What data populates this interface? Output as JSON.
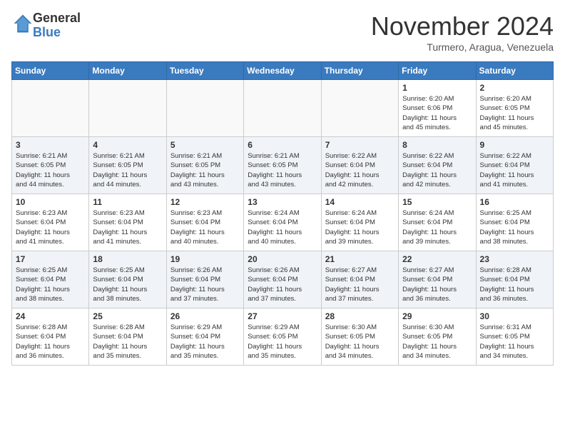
{
  "logo": {
    "line1": "General",
    "line2": "Blue"
  },
  "title": "November 2024",
  "location": "Turmero, Aragua, Venezuela",
  "weekdays": [
    "Sunday",
    "Monday",
    "Tuesday",
    "Wednesday",
    "Thursday",
    "Friday",
    "Saturday"
  ],
  "weeks": [
    [
      {
        "day": "",
        "info": ""
      },
      {
        "day": "",
        "info": ""
      },
      {
        "day": "",
        "info": ""
      },
      {
        "day": "",
        "info": ""
      },
      {
        "day": "",
        "info": ""
      },
      {
        "day": "1",
        "info": "Sunrise: 6:20 AM\nSunset: 6:06 PM\nDaylight: 11 hours\nand 45 minutes."
      },
      {
        "day": "2",
        "info": "Sunrise: 6:20 AM\nSunset: 6:05 PM\nDaylight: 11 hours\nand 45 minutes."
      }
    ],
    [
      {
        "day": "3",
        "info": "Sunrise: 6:21 AM\nSunset: 6:05 PM\nDaylight: 11 hours\nand 44 minutes."
      },
      {
        "day": "4",
        "info": "Sunrise: 6:21 AM\nSunset: 6:05 PM\nDaylight: 11 hours\nand 44 minutes."
      },
      {
        "day": "5",
        "info": "Sunrise: 6:21 AM\nSunset: 6:05 PM\nDaylight: 11 hours\nand 43 minutes."
      },
      {
        "day": "6",
        "info": "Sunrise: 6:21 AM\nSunset: 6:05 PM\nDaylight: 11 hours\nand 43 minutes."
      },
      {
        "day": "7",
        "info": "Sunrise: 6:22 AM\nSunset: 6:04 PM\nDaylight: 11 hours\nand 42 minutes."
      },
      {
        "day": "8",
        "info": "Sunrise: 6:22 AM\nSunset: 6:04 PM\nDaylight: 11 hours\nand 42 minutes."
      },
      {
        "day": "9",
        "info": "Sunrise: 6:22 AM\nSunset: 6:04 PM\nDaylight: 11 hours\nand 41 minutes."
      }
    ],
    [
      {
        "day": "10",
        "info": "Sunrise: 6:23 AM\nSunset: 6:04 PM\nDaylight: 11 hours\nand 41 minutes."
      },
      {
        "day": "11",
        "info": "Sunrise: 6:23 AM\nSunset: 6:04 PM\nDaylight: 11 hours\nand 41 minutes."
      },
      {
        "day": "12",
        "info": "Sunrise: 6:23 AM\nSunset: 6:04 PM\nDaylight: 11 hours\nand 40 minutes."
      },
      {
        "day": "13",
        "info": "Sunrise: 6:24 AM\nSunset: 6:04 PM\nDaylight: 11 hours\nand 40 minutes."
      },
      {
        "day": "14",
        "info": "Sunrise: 6:24 AM\nSunset: 6:04 PM\nDaylight: 11 hours\nand 39 minutes."
      },
      {
        "day": "15",
        "info": "Sunrise: 6:24 AM\nSunset: 6:04 PM\nDaylight: 11 hours\nand 39 minutes."
      },
      {
        "day": "16",
        "info": "Sunrise: 6:25 AM\nSunset: 6:04 PM\nDaylight: 11 hours\nand 38 minutes."
      }
    ],
    [
      {
        "day": "17",
        "info": "Sunrise: 6:25 AM\nSunset: 6:04 PM\nDaylight: 11 hours\nand 38 minutes."
      },
      {
        "day": "18",
        "info": "Sunrise: 6:25 AM\nSunset: 6:04 PM\nDaylight: 11 hours\nand 38 minutes."
      },
      {
        "day": "19",
        "info": "Sunrise: 6:26 AM\nSunset: 6:04 PM\nDaylight: 11 hours\nand 37 minutes."
      },
      {
        "day": "20",
        "info": "Sunrise: 6:26 AM\nSunset: 6:04 PM\nDaylight: 11 hours\nand 37 minutes."
      },
      {
        "day": "21",
        "info": "Sunrise: 6:27 AM\nSunset: 6:04 PM\nDaylight: 11 hours\nand 37 minutes."
      },
      {
        "day": "22",
        "info": "Sunrise: 6:27 AM\nSunset: 6:04 PM\nDaylight: 11 hours\nand 36 minutes."
      },
      {
        "day": "23",
        "info": "Sunrise: 6:28 AM\nSunset: 6:04 PM\nDaylight: 11 hours\nand 36 minutes."
      }
    ],
    [
      {
        "day": "24",
        "info": "Sunrise: 6:28 AM\nSunset: 6:04 PM\nDaylight: 11 hours\nand 36 minutes."
      },
      {
        "day": "25",
        "info": "Sunrise: 6:28 AM\nSunset: 6:04 PM\nDaylight: 11 hours\nand 35 minutes."
      },
      {
        "day": "26",
        "info": "Sunrise: 6:29 AM\nSunset: 6:04 PM\nDaylight: 11 hours\nand 35 minutes."
      },
      {
        "day": "27",
        "info": "Sunrise: 6:29 AM\nSunset: 6:05 PM\nDaylight: 11 hours\nand 35 minutes."
      },
      {
        "day": "28",
        "info": "Sunrise: 6:30 AM\nSunset: 6:05 PM\nDaylight: 11 hours\nand 34 minutes."
      },
      {
        "day": "29",
        "info": "Sunrise: 6:30 AM\nSunset: 6:05 PM\nDaylight: 11 hours\nand 34 minutes."
      },
      {
        "day": "30",
        "info": "Sunrise: 6:31 AM\nSunset: 6:05 PM\nDaylight: 11 hours\nand 34 minutes."
      }
    ]
  ]
}
